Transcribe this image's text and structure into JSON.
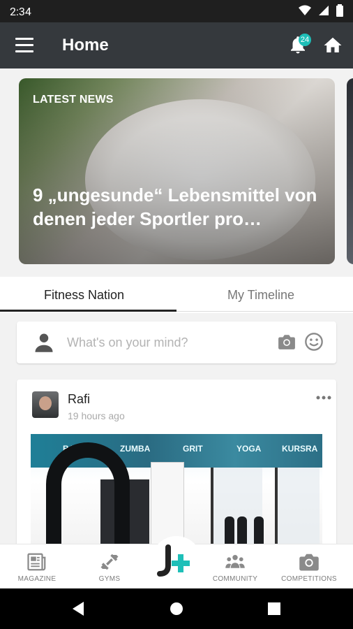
{
  "status_bar": {
    "time": "2:34"
  },
  "app_bar": {
    "title": "Home",
    "notification_count": "24"
  },
  "news": {
    "eyebrow": "LATEST NEWS",
    "headline": "9 „ungesunde“ Lebensmittel von denen jeder Sportler pro…"
  },
  "tabs": [
    {
      "label": "Fitness Nation",
      "active": true
    },
    {
      "label": "My Timeline",
      "active": false
    }
  ],
  "composer": {
    "placeholder": "What's on your mind?"
  },
  "post": {
    "author": "Rafi",
    "time": "19 hours ago",
    "photo_signs": [
      "BALANCE",
      "ZUMBA",
      "GRIT",
      "YOGA",
      "KURSRA"
    ]
  },
  "bottom_nav": [
    {
      "label": "MAGAZINE",
      "icon": "newspaper-icon"
    },
    {
      "label": "GYMS",
      "icon": "dumbbell-icon"
    },
    {
      "label": "",
      "icon": "app-logo-icon"
    },
    {
      "label": "COMMUNITY",
      "icon": "community-icon"
    },
    {
      "label": "COMPETITIONS",
      "icon": "camera-icon"
    }
  ],
  "colors": {
    "app_bar": "#35393d",
    "accent": "#1ebfb8",
    "status_bar": "#1f1f1f"
  }
}
